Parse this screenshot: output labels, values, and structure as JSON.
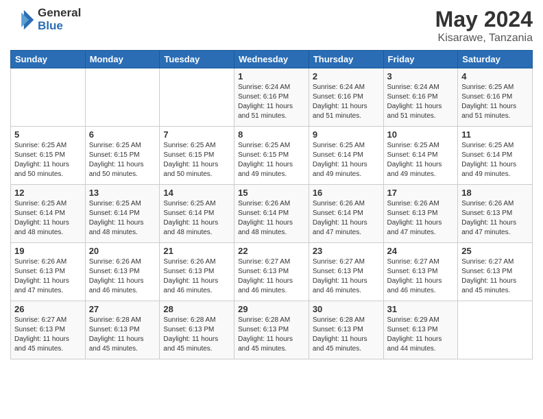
{
  "logo": {
    "general": "General",
    "blue": "Blue"
  },
  "header": {
    "month_year": "May 2024",
    "location": "Kisarawe, Tanzania"
  },
  "days_of_week": [
    "Sunday",
    "Monday",
    "Tuesday",
    "Wednesday",
    "Thursday",
    "Friday",
    "Saturday"
  ],
  "weeks": [
    [
      {
        "day": "",
        "info": ""
      },
      {
        "day": "",
        "info": ""
      },
      {
        "day": "",
        "info": ""
      },
      {
        "day": "1",
        "info": "Sunrise: 6:24 AM\nSunset: 6:16 PM\nDaylight: 11 hours\nand 51 minutes."
      },
      {
        "day": "2",
        "info": "Sunrise: 6:24 AM\nSunset: 6:16 PM\nDaylight: 11 hours\nand 51 minutes."
      },
      {
        "day": "3",
        "info": "Sunrise: 6:24 AM\nSunset: 6:16 PM\nDaylight: 11 hours\nand 51 minutes."
      },
      {
        "day": "4",
        "info": "Sunrise: 6:25 AM\nSunset: 6:16 PM\nDaylight: 11 hours\nand 51 minutes."
      }
    ],
    [
      {
        "day": "5",
        "info": "Sunrise: 6:25 AM\nSunset: 6:15 PM\nDaylight: 11 hours\nand 50 minutes."
      },
      {
        "day": "6",
        "info": "Sunrise: 6:25 AM\nSunset: 6:15 PM\nDaylight: 11 hours\nand 50 minutes."
      },
      {
        "day": "7",
        "info": "Sunrise: 6:25 AM\nSunset: 6:15 PM\nDaylight: 11 hours\nand 50 minutes."
      },
      {
        "day": "8",
        "info": "Sunrise: 6:25 AM\nSunset: 6:15 PM\nDaylight: 11 hours\nand 49 minutes."
      },
      {
        "day": "9",
        "info": "Sunrise: 6:25 AM\nSunset: 6:14 PM\nDaylight: 11 hours\nand 49 minutes."
      },
      {
        "day": "10",
        "info": "Sunrise: 6:25 AM\nSunset: 6:14 PM\nDaylight: 11 hours\nand 49 minutes."
      },
      {
        "day": "11",
        "info": "Sunrise: 6:25 AM\nSunset: 6:14 PM\nDaylight: 11 hours\nand 49 minutes."
      }
    ],
    [
      {
        "day": "12",
        "info": "Sunrise: 6:25 AM\nSunset: 6:14 PM\nDaylight: 11 hours\nand 48 minutes."
      },
      {
        "day": "13",
        "info": "Sunrise: 6:25 AM\nSunset: 6:14 PM\nDaylight: 11 hours\nand 48 minutes."
      },
      {
        "day": "14",
        "info": "Sunrise: 6:25 AM\nSunset: 6:14 PM\nDaylight: 11 hours\nand 48 minutes."
      },
      {
        "day": "15",
        "info": "Sunrise: 6:26 AM\nSunset: 6:14 PM\nDaylight: 11 hours\nand 48 minutes."
      },
      {
        "day": "16",
        "info": "Sunrise: 6:26 AM\nSunset: 6:14 PM\nDaylight: 11 hours\nand 47 minutes."
      },
      {
        "day": "17",
        "info": "Sunrise: 6:26 AM\nSunset: 6:13 PM\nDaylight: 11 hours\nand 47 minutes."
      },
      {
        "day": "18",
        "info": "Sunrise: 6:26 AM\nSunset: 6:13 PM\nDaylight: 11 hours\nand 47 minutes."
      }
    ],
    [
      {
        "day": "19",
        "info": "Sunrise: 6:26 AM\nSunset: 6:13 PM\nDaylight: 11 hours\nand 47 minutes."
      },
      {
        "day": "20",
        "info": "Sunrise: 6:26 AM\nSunset: 6:13 PM\nDaylight: 11 hours\nand 46 minutes."
      },
      {
        "day": "21",
        "info": "Sunrise: 6:26 AM\nSunset: 6:13 PM\nDaylight: 11 hours\nand 46 minutes."
      },
      {
        "day": "22",
        "info": "Sunrise: 6:27 AM\nSunset: 6:13 PM\nDaylight: 11 hours\nand 46 minutes."
      },
      {
        "day": "23",
        "info": "Sunrise: 6:27 AM\nSunset: 6:13 PM\nDaylight: 11 hours\nand 46 minutes."
      },
      {
        "day": "24",
        "info": "Sunrise: 6:27 AM\nSunset: 6:13 PM\nDaylight: 11 hours\nand 46 minutes."
      },
      {
        "day": "25",
        "info": "Sunrise: 6:27 AM\nSunset: 6:13 PM\nDaylight: 11 hours\nand 45 minutes."
      }
    ],
    [
      {
        "day": "26",
        "info": "Sunrise: 6:27 AM\nSunset: 6:13 PM\nDaylight: 11 hours\nand 45 minutes."
      },
      {
        "day": "27",
        "info": "Sunrise: 6:28 AM\nSunset: 6:13 PM\nDaylight: 11 hours\nand 45 minutes."
      },
      {
        "day": "28",
        "info": "Sunrise: 6:28 AM\nSunset: 6:13 PM\nDaylight: 11 hours\nand 45 minutes."
      },
      {
        "day": "29",
        "info": "Sunrise: 6:28 AM\nSunset: 6:13 PM\nDaylight: 11 hours\nand 45 minutes."
      },
      {
        "day": "30",
        "info": "Sunrise: 6:28 AM\nSunset: 6:13 PM\nDaylight: 11 hours\nand 45 minutes."
      },
      {
        "day": "31",
        "info": "Sunrise: 6:29 AM\nSunset: 6:13 PM\nDaylight: 11 hours\nand 44 minutes."
      },
      {
        "day": "",
        "info": ""
      }
    ]
  ]
}
